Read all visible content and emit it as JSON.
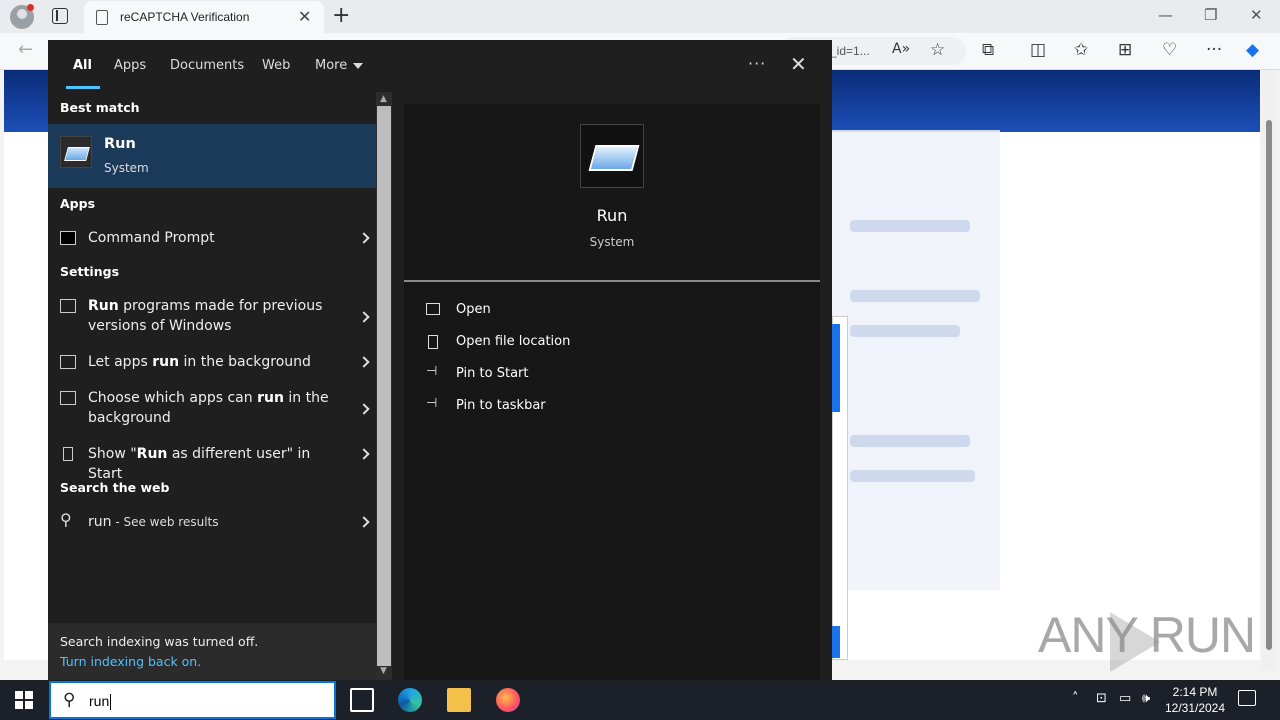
{
  "browser": {
    "tab_title": "reCAPTCHA Verification",
    "address_fragment": "_id=1...",
    "window_controls": {
      "minimize": "—",
      "restore": "❐",
      "close": "✕"
    },
    "new_tab": "+"
  },
  "search_panel": {
    "filters": [
      "All",
      "Apps",
      "Documents",
      "Web",
      "More"
    ],
    "best_match_heading": "Best match",
    "best_match": {
      "title": "Run",
      "subtitle": "System"
    },
    "apps_heading": "Apps",
    "apps": [
      "Command Prompt"
    ],
    "settings_heading": "Settings",
    "settings": [
      {
        "pre": "",
        "bold": "Run",
        "post": " programs made for previous versions of Windows"
      },
      {
        "pre": "Let apps ",
        "bold": "run",
        "post": " in the background"
      },
      {
        "pre": "Choose which apps can ",
        "bold": "run",
        "post": " in the background"
      },
      {
        "pre": "Show \"",
        "bold": "Run",
        "post": " as different user\" in Start"
      }
    ],
    "web_heading": "Search the web",
    "web": {
      "query": "run",
      "suffix": " - See web results"
    },
    "indexing": {
      "message": "Search indexing was turned off.",
      "link": "Turn indexing back on."
    },
    "preview": {
      "title": "Run",
      "subtitle": "System",
      "actions": [
        "Open",
        "Open file location",
        "Pin to Start",
        "Pin to taskbar"
      ]
    }
  },
  "taskbar": {
    "search_value": "run",
    "time": "2:14 PM",
    "date": "12/31/2024"
  },
  "watermark": "ANY RUN"
}
